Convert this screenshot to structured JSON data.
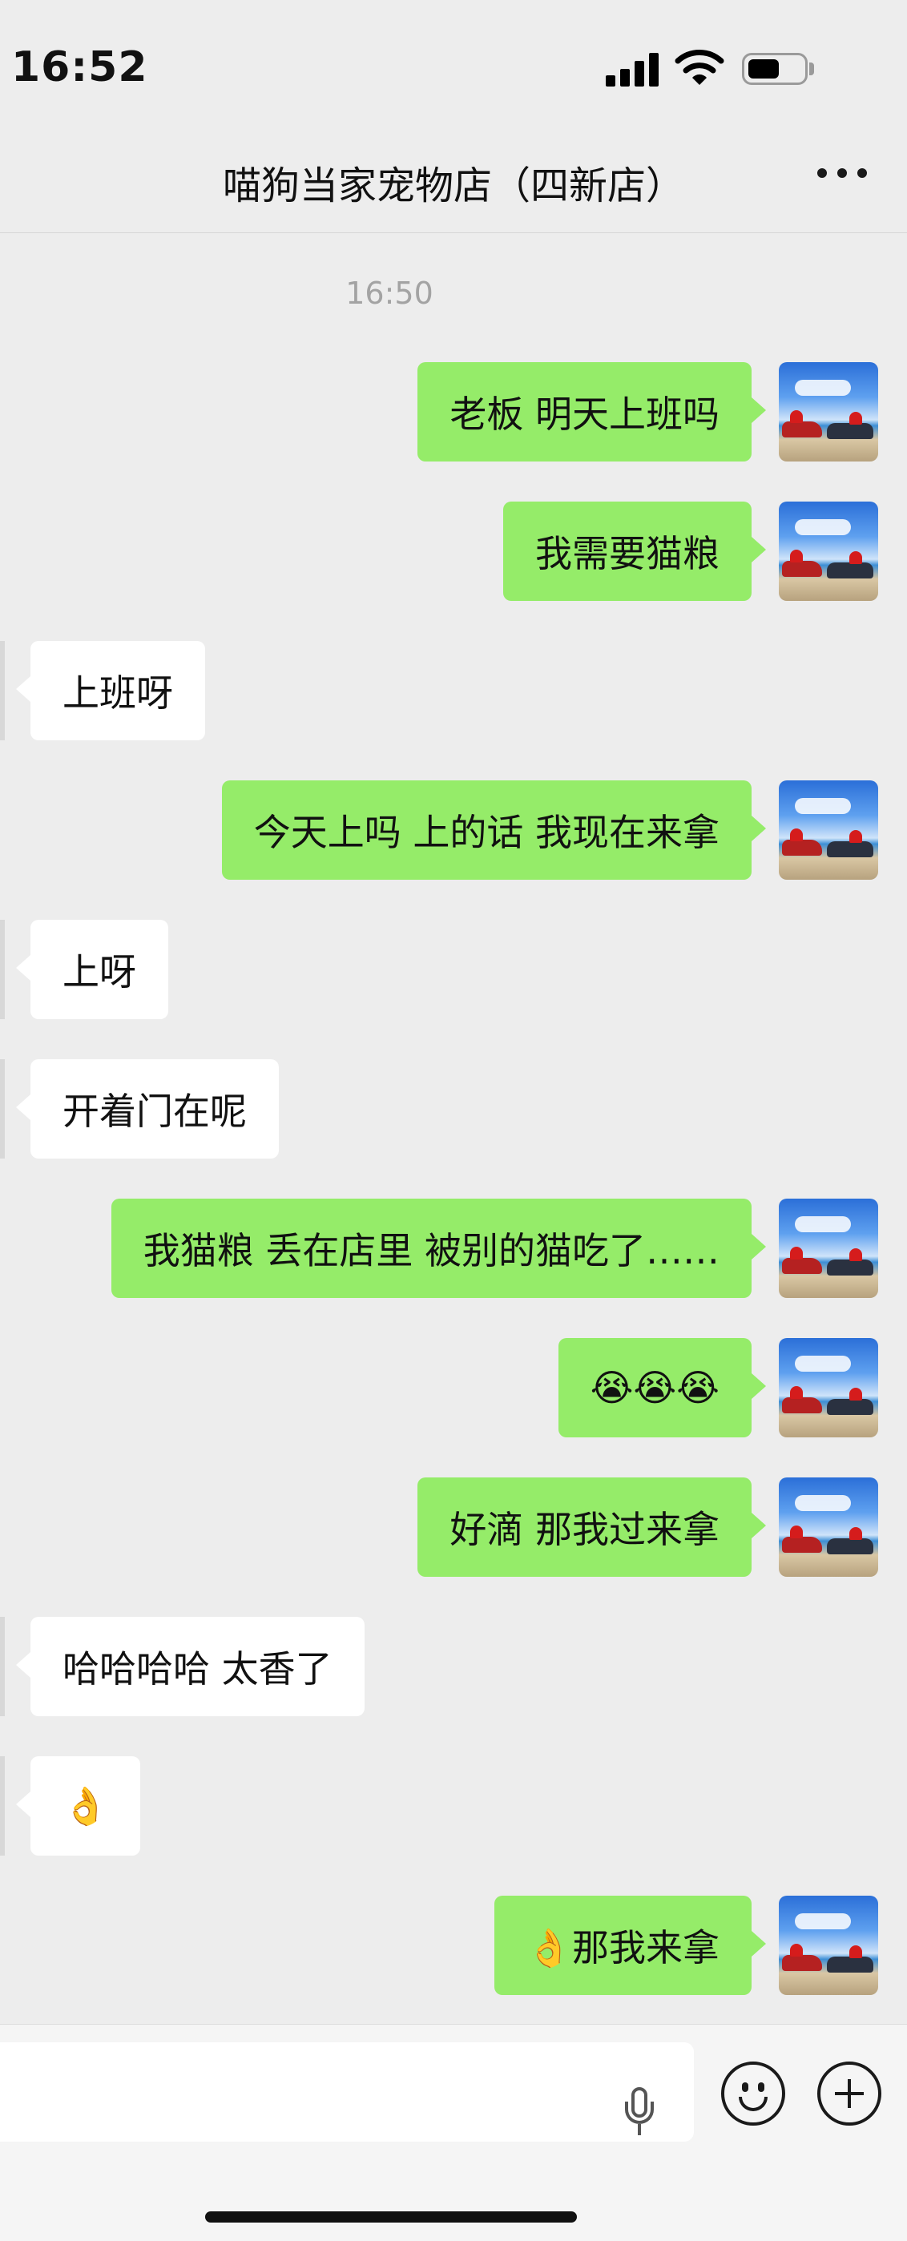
{
  "status_bar": {
    "time": "16:52"
  },
  "header": {
    "title": "喵狗当家宠物店（四新店）"
  },
  "chat": {
    "timestamp": "16:50",
    "messages": [
      {
        "side": "out",
        "text": "老板 明天上班吗"
      },
      {
        "side": "out",
        "text": "我需要猫粮"
      },
      {
        "side": "in",
        "text": "上班呀"
      },
      {
        "side": "out",
        "text": "今天上吗 上的话 我现在来拿"
      },
      {
        "side": "in",
        "text": "上呀"
      },
      {
        "side": "in",
        "text": "开着门在呢"
      },
      {
        "side": "out",
        "text": "我猫粮 丢在店里 被别的猫吃了……"
      },
      {
        "side": "out",
        "text": "😭😭😭"
      },
      {
        "side": "out",
        "text": "好滴 那我过来拿"
      },
      {
        "side": "in",
        "text": "哈哈哈哈 太香了"
      },
      {
        "side": "in",
        "text": "👌"
      },
      {
        "side": "out",
        "text": "👌那我来拿"
      }
    ]
  },
  "icons": {
    "more": "more-icon",
    "mic": "microphone-icon",
    "emoji": "emoji-icon",
    "plus": "plus-icon"
  },
  "colors": {
    "outgoing_bubble": "#95ec69",
    "incoming_bubble": "#ffffff",
    "background": "#ededed"
  }
}
